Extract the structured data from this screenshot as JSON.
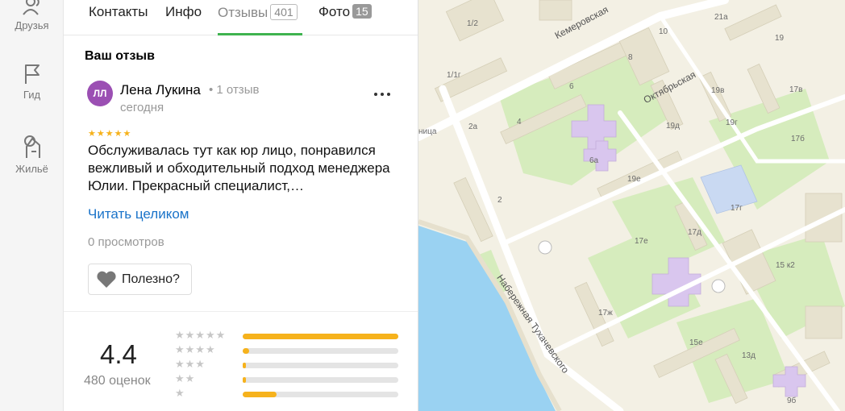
{
  "rail": {
    "items": [
      {
        "label": "Друзья",
        "icon": "friends-icon"
      },
      {
        "label": "Гид",
        "icon": "flag-icon"
      },
      {
        "label": "Жильё",
        "icon": "housing-icon"
      }
    ]
  },
  "tabs": [
    {
      "label": "Контакты",
      "badge": ""
    },
    {
      "label": "Инфо",
      "badge": ""
    },
    {
      "label": "Отзывы",
      "badge": "401"
    },
    {
      "label": "Фото",
      "badge": "15"
    }
  ],
  "review": {
    "section_title": "Ваш отзыв",
    "avatar_initials": "ЛЛ",
    "author": "Лена Лукина",
    "author_meta": "• 1 отзыв",
    "date": "сегодня",
    "stars": "★★★★★",
    "rating": 5,
    "text": "Обслуживалась тут как юр лицо, понравился вежливый и обходительный подход менеджера Юлии. Прекрасный специалист,…",
    "read_more": "Читать целиком",
    "views": "0 просмотров",
    "useful_label": "Полезно?"
  },
  "rating": {
    "value": "4.4",
    "count": "480 оценок",
    "distribution": [
      {
        "stars": "★★★★★",
        "fraction": 1.0
      },
      {
        "stars": "★★★★",
        "fraction": 0.04
      },
      {
        "stars": "★★★",
        "fraction": 0.02
      },
      {
        "stars": "★★",
        "fraction": 0.02
      },
      {
        "stars": "★",
        "fraction": 0.22
      }
    ]
  },
  "map": {
    "colors": {
      "water": "#9ad2f2",
      "land": "#f3f0e4",
      "green": "#d6ecbd",
      "building": "#e7e2cf",
      "road": "#ffffff",
      "school": "#d9c6ee"
    },
    "streets": [
      "Кемеровская",
      "Октябрьская",
      "Набережная Тухачевского"
    ],
    "labels": [
      "1/2",
      "1/1г",
      "2а",
      "2",
      "4",
      "6",
      "8",
      "10",
      "21а",
      "19",
      "19в",
      "19г",
      "19д",
      "19е",
      "17в",
      "17б",
      "17г",
      "17д",
      "17е",
      "17ж",
      "15 к2",
      "15е",
      "13д",
      "9б",
      "6а",
      "ница"
    ]
  }
}
